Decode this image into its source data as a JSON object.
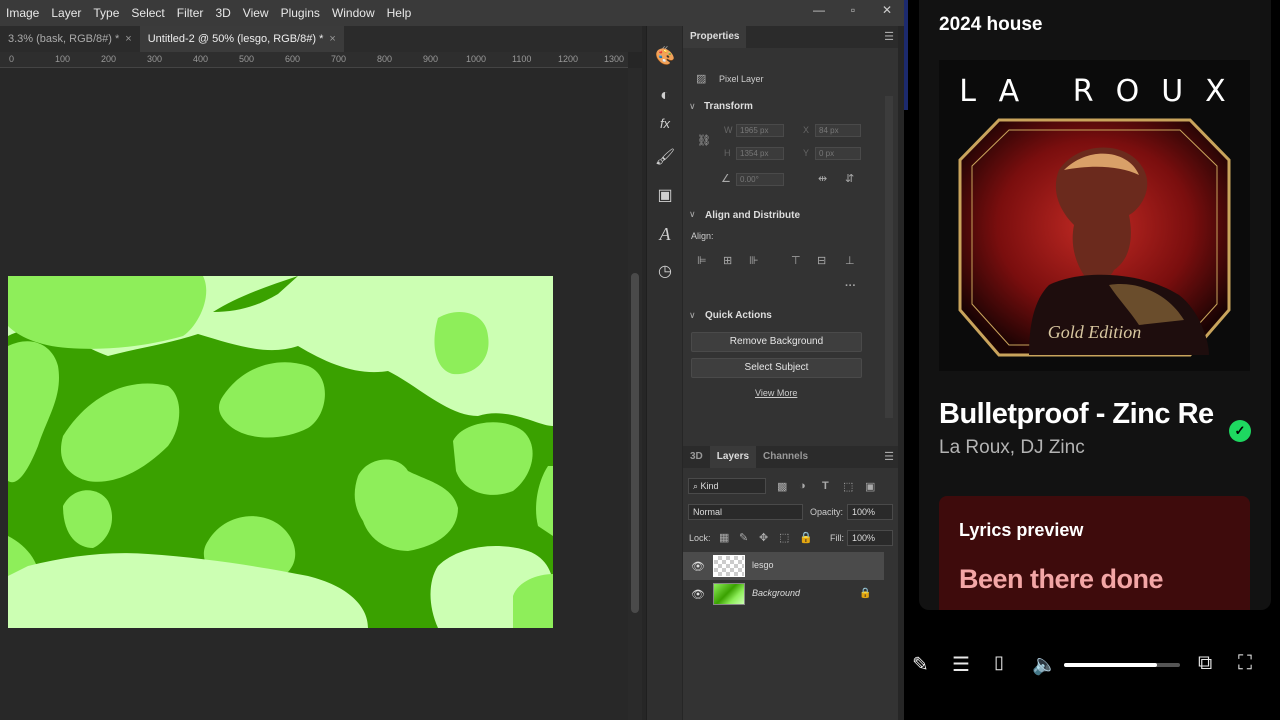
{
  "photoshop": {
    "menu": [
      "Image",
      "Layer",
      "Type",
      "Select",
      "Filter",
      "3D",
      "View",
      "Plugins",
      "Window",
      "Help"
    ],
    "tabs": [
      {
        "label": "3.3% (bask, RGB/8#) *",
        "close": "×"
      },
      {
        "label": "Untitled-2 @ 50% (lesgo, RGB/8#) *",
        "close": "×"
      }
    ],
    "ruler_ticks": [
      "0",
      "100",
      "200",
      "300",
      "400",
      "500",
      "600",
      "700",
      "800",
      "900",
      "1000",
      "1100",
      "1200",
      "1300"
    ],
    "properties": {
      "tab_label": "Properties",
      "layer_type": "Pixel Layer",
      "transform": {
        "title": "Transform",
        "w_label": "W",
        "w_value": "1965 px",
        "x_label": "X",
        "x_value": "84 px",
        "h_label": "H",
        "h_value": "1354 px",
        "y_label": "Y",
        "y_value": "0 px",
        "angle_value": "0.00°"
      },
      "align": {
        "title": "Align and Distribute",
        "align_label": "Align:"
      },
      "quick_actions": {
        "title": "Quick Actions",
        "remove_bg": "Remove Background",
        "select_subject": "Select Subject",
        "view_more": "View More"
      }
    },
    "layers_panel": {
      "tabs": [
        "3D",
        "Layers",
        "Channels"
      ],
      "filter_kind": "Kind",
      "blend_mode": "Normal",
      "opacity_label": "Opacity:",
      "opacity_value": "100%",
      "lock_label": "Lock:",
      "fill_label": "Fill:",
      "fill_value": "100%",
      "layers": [
        {
          "name": "lesgo",
          "selected": true
        },
        {
          "name": "Background",
          "selected": false
        }
      ]
    },
    "colors": {
      "canvas_light": "#ccffb3",
      "canvas_mid": "#8eee5a",
      "canvas_dark": "#3aa100"
    }
  },
  "spotify": {
    "playlist_title": "2024 house",
    "album_art_text": "LA ROUX",
    "album_art_edition": "Gold Edition",
    "track_title": "Bulletproof - Zinc Re",
    "artists": "La Roux, DJ Zinc",
    "lyrics_header": "Lyrics preview",
    "lyrics_line": "Been there done",
    "volume_level": 0.8,
    "accent": "#1ed760",
    "lyrics_bg": "#3e0b0c"
  }
}
